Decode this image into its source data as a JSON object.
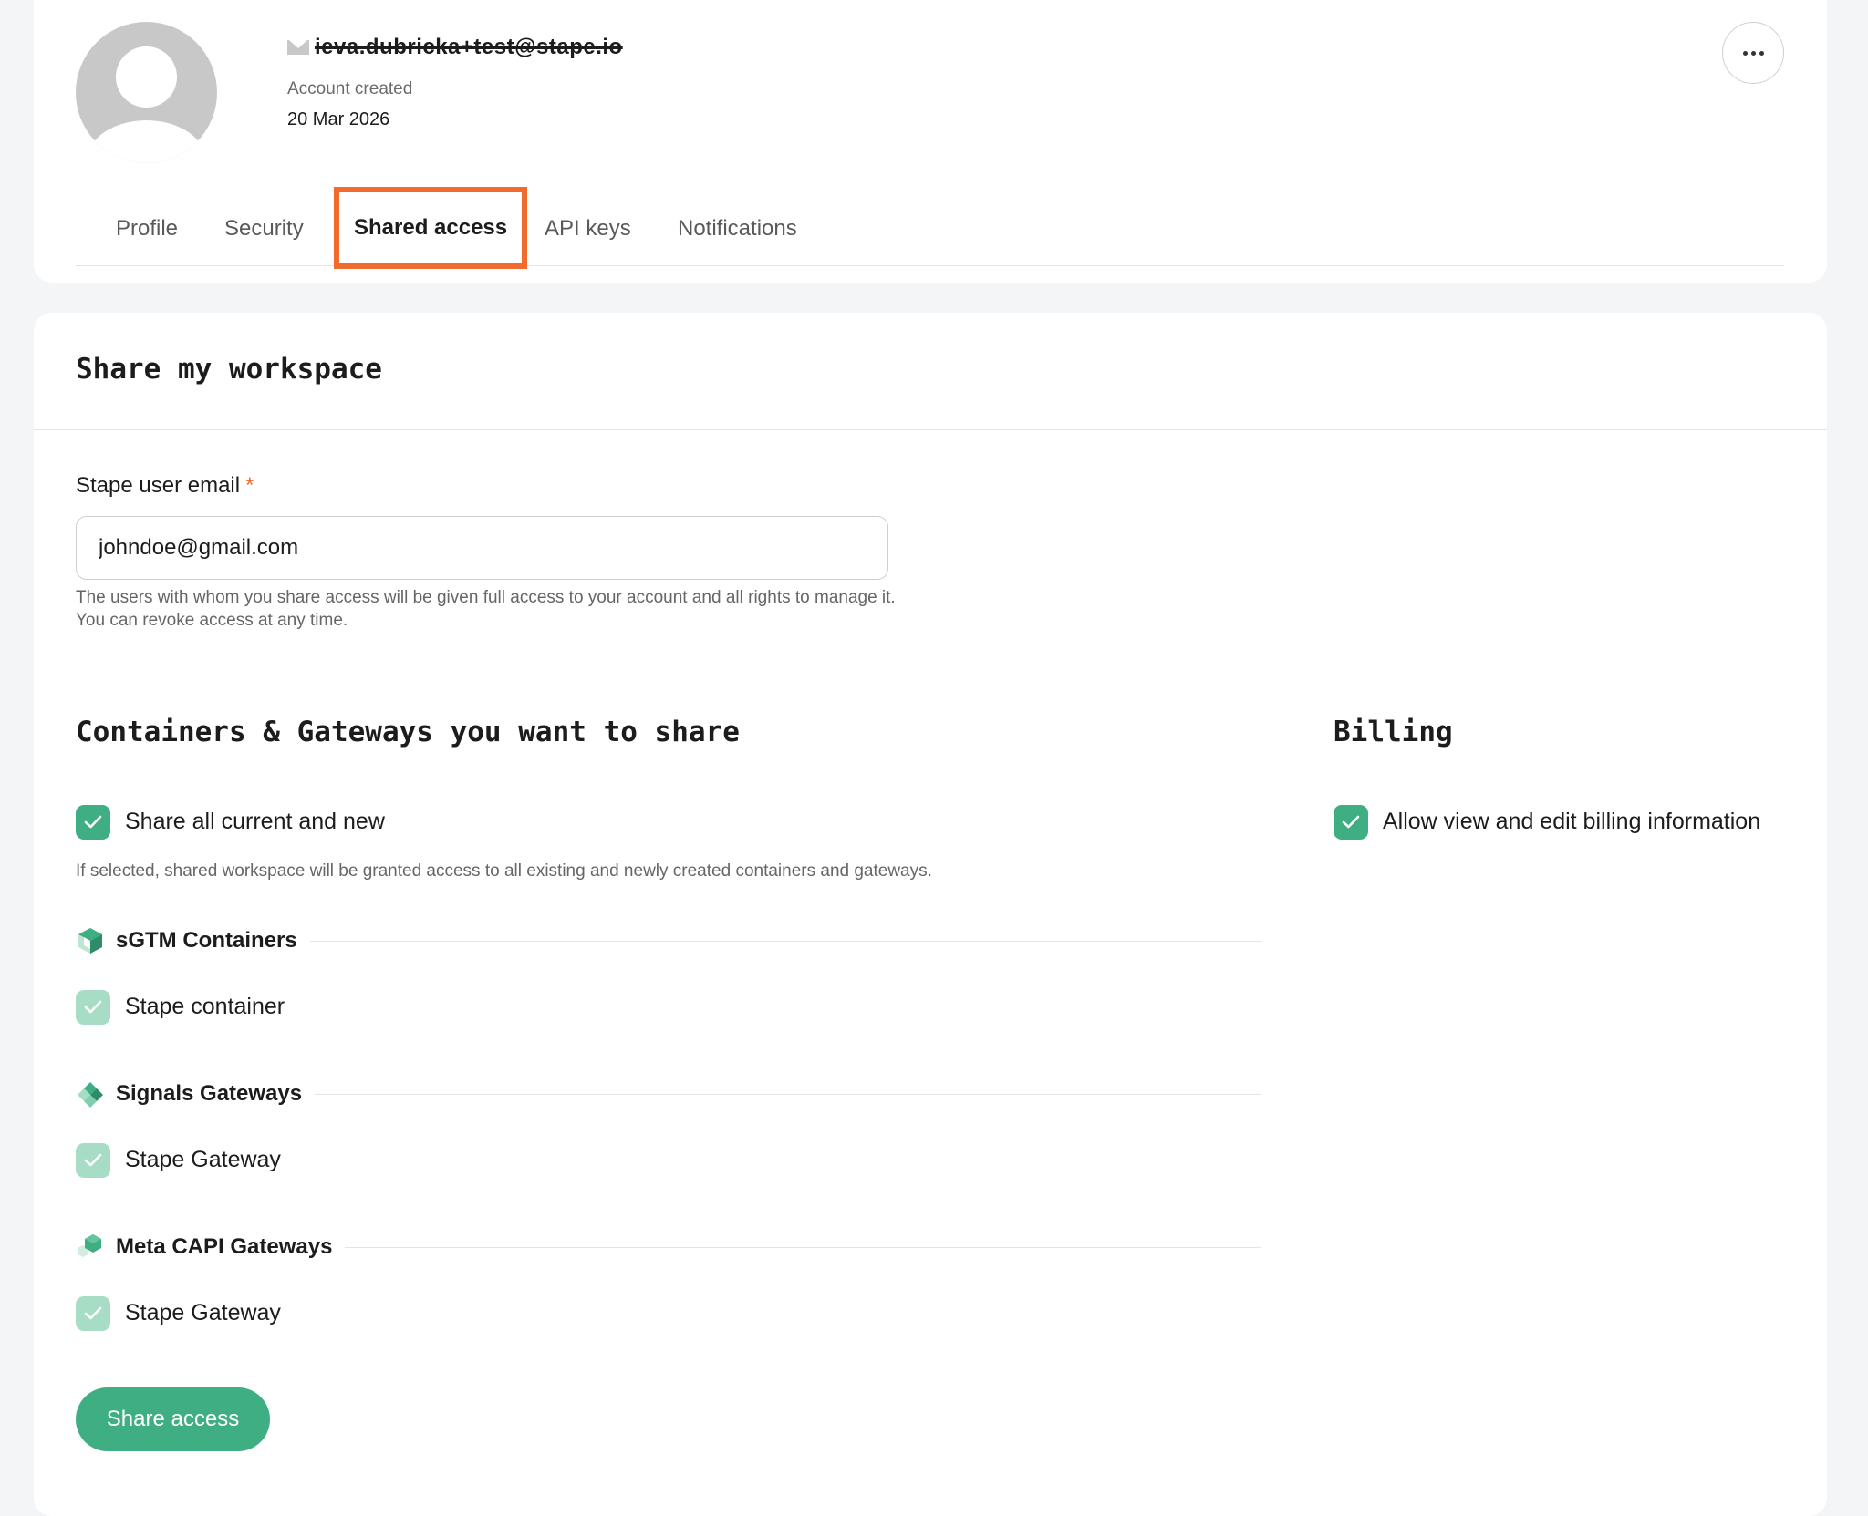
{
  "header": {
    "email": "ieva.dubricka+test@stape.io",
    "account_created_label": "Account created",
    "account_created_date": "20 Mar 2026"
  },
  "tabs": [
    {
      "label": "Profile"
    },
    {
      "label": "Security"
    },
    {
      "label": "Shared access",
      "active": true
    },
    {
      "label": "API keys"
    },
    {
      "label": "Notifications"
    }
  ],
  "share": {
    "title": "Share my workspace",
    "email_label": "Stape user email",
    "required_mark": "*",
    "email_value": "johndoe@gmail.com",
    "email_hint": "The users with whom you share access will be given full access to your account and all rights to manage it. You can revoke access at any time.",
    "containers_title": "Containers & Gateways you want to share",
    "share_all_label": "Share all current and new",
    "share_all_hint": "If selected, shared workspace will be granted access to all existing and newly created containers and gateways.",
    "groups": [
      {
        "title": "sGTM Containers",
        "icon": "cube-icon",
        "items": [
          "Stape container"
        ]
      },
      {
        "title": "Signals Gateways",
        "icon": "diamonds-icon",
        "items": [
          "Stape Gateway"
        ]
      },
      {
        "title": "Meta CAPI Gateways",
        "icon": "hexagon-icon",
        "items": [
          "Stape Gateway"
        ]
      }
    ],
    "billing_title": "Billing",
    "billing_label": "Allow view and edit billing information",
    "submit_label": "Share access"
  },
  "colors": {
    "accent_green": "#3fae83",
    "light_green": "#a7dcc5",
    "highlight_orange": "#f26a2e"
  }
}
